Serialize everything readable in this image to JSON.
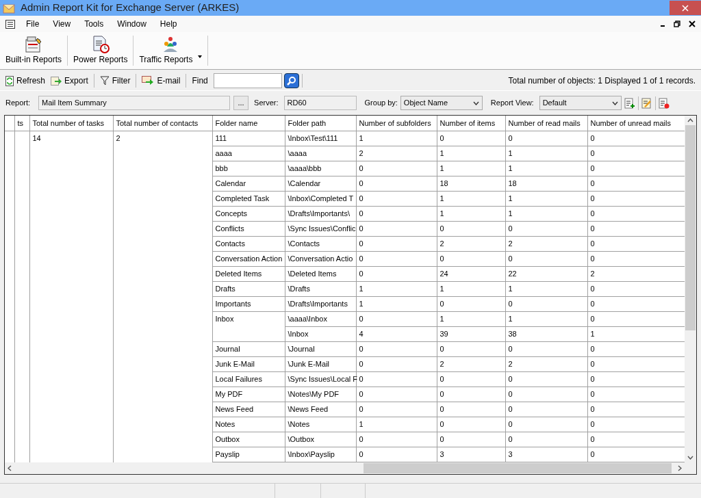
{
  "window": {
    "title": "Admin Report Kit for Exchange Server (ARKES)"
  },
  "menu": [
    "File",
    "View",
    "Tools",
    "Window",
    "Help"
  ],
  "big_toolbar": [
    {
      "label": "Built-in Reports",
      "kind": "report"
    },
    {
      "label": "Power Reports",
      "kind": "power"
    },
    {
      "label": "Traffic Reports",
      "kind": "traffic"
    }
  ],
  "toolbar": {
    "refresh": "Refresh",
    "export": "Export",
    "filter": "Filter",
    "email": "E-mail",
    "find_label": "Find",
    "status": "Total number of objects: 1  Displayed 1 of 1 records."
  },
  "params": {
    "report_label": "Report:",
    "report_value": "Mail Item Summary",
    "browse": "...",
    "server_label": "Server:",
    "server_value": "RD60",
    "group_label": "Group by:",
    "group_value": "Object Name",
    "view_label": "Report View:",
    "view_value": "Default"
  },
  "table": {
    "columns": [
      "ts",
      "Total number of tasks",
      "Total number of contacts",
      "Folder name",
      "Folder path",
      "Number of subfolders",
      "Number of items",
      "Number of read mails",
      "Number of unread mails"
    ],
    "summary": {
      "tasks": "14",
      "contacts": "2"
    },
    "rows": [
      {
        "folder_name": "111",
        "entries": [
          [
            "\\Inbox\\Test\\111",
            "1",
            "0",
            "0",
            "0"
          ]
        ]
      },
      {
        "folder_name": "aaaa",
        "entries": [
          [
            "\\aaaa",
            "2",
            "1",
            "1",
            "0"
          ]
        ]
      },
      {
        "folder_name": "bbb",
        "entries": [
          [
            "\\aaaa\\bbb",
            "0",
            "1",
            "1",
            "0"
          ]
        ]
      },
      {
        "folder_name": "Calendar",
        "entries": [
          [
            "\\Calendar",
            "0",
            "18",
            "18",
            "0"
          ]
        ]
      },
      {
        "folder_name": "Completed Task",
        "entries": [
          [
            "\\Inbox\\Completed T",
            "0",
            "1",
            "1",
            "0"
          ]
        ]
      },
      {
        "folder_name": "Concepts",
        "entries": [
          [
            "\\Drafts\\Importants\\",
            "0",
            "1",
            "1",
            "0"
          ]
        ]
      },
      {
        "folder_name": "Conflicts",
        "entries": [
          [
            "\\Sync Issues\\Conflic",
            "0",
            "0",
            "0",
            "0"
          ]
        ]
      },
      {
        "folder_name": "Contacts",
        "entries": [
          [
            "\\Contacts",
            "0",
            "2",
            "2",
            "0"
          ]
        ]
      },
      {
        "folder_name": "Conversation Action",
        "entries": [
          [
            "\\Conversation Actio",
            "0",
            "0",
            "0",
            "0"
          ]
        ]
      },
      {
        "folder_name": "Deleted Items",
        "entries": [
          [
            "\\Deleted Items",
            "0",
            "24",
            "22",
            "2"
          ]
        ]
      },
      {
        "folder_name": "Drafts",
        "entries": [
          [
            "\\Drafts",
            "1",
            "1",
            "1",
            "0"
          ]
        ]
      },
      {
        "folder_name": "Importants",
        "entries": [
          [
            "\\Drafts\\Importants",
            "1",
            "0",
            "0",
            "0"
          ]
        ]
      },
      {
        "folder_name": "Inbox",
        "entries": [
          [
            "\\aaaa\\Inbox",
            "0",
            "1",
            "1",
            "0"
          ],
          [
            "\\Inbox",
            "4",
            "39",
            "38",
            "1"
          ]
        ]
      },
      {
        "folder_name": "Journal",
        "entries": [
          [
            "\\Journal",
            "0",
            "0",
            "0",
            "0"
          ]
        ]
      },
      {
        "folder_name": "Junk E-Mail",
        "entries": [
          [
            "\\Junk E-Mail",
            "0",
            "2",
            "2",
            "0"
          ]
        ]
      },
      {
        "folder_name": "Local Failures",
        "entries": [
          [
            "\\Sync Issues\\Local F",
            "0",
            "0",
            "0",
            "0"
          ]
        ]
      },
      {
        "folder_name": "My PDF",
        "entries": [
          [
            "\\Notes\\My PDF",
            "0",
            "0",
            "0",
            "0"
          ]
        ]
      },
      {
        "folder_name": "News Feed",
        "entries": [
          [
            "\\News Feed",
            "0",
            "0",
            "0",
            "0"
          ]
        ]
      },
      {
        "folder_name": "Notes",
        "entries": [
          [
            "\\Notes",
            "1",
            "0",
            "0",
            "0"
          ]
        ]
      },
      {
        "folder_name": "Outbox",
        "entries": [
          [
            "\\Outbox",
            "0",
            "0",
            "0",
            "0"
          ]
        ]
      },
      {
        "folder_name": "Payslip",
        "entries": [
          [
            "\\Inbox\\Payslip",
            "0",
            "3",
            "3",
            "0"
          ]
        ]
      }
    ]
  }
}
